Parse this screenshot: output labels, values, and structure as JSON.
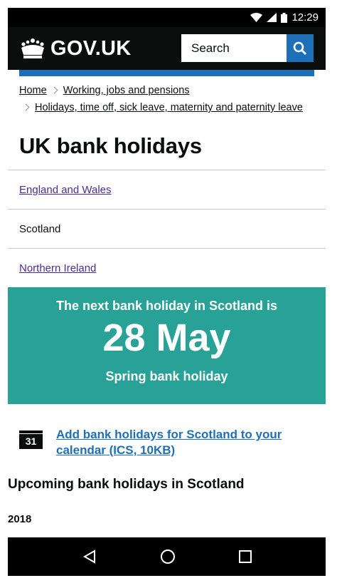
{
  "status": {
    "time": "12:29"
  },
  "header": {
    "logo_text": "GOV.UK",
    "search_placeholder": "Search"
  },
  "breadcrumbs": [
    "Home",
    "Working, jobs and pensions",
    "Holidays, time off, sick leave, maternity and paternity leave"
  ],
  "page_title": "UK bank holidays",
  "tabs": [
    {
      "label": "England and Wales",
      "current": false
    },
    {
      "label": "Scotland",
      "current": true
    },
    {
      "label": "Northern Ireland",
      "current": false
    }
  ],
  "highlight": {
    "intro": "The next bank holiday in Scotland is",
    "date": "28 May",
    "name": "Spring bank holiday"
  },
  "calendar": {
    "icon_day": "31",
    "link_text": "Add bank holidays for Scotland to your calendar (ICS, 10KB)"
  },
  "upcoming_heading": "Upcoming bank holidays in Scotland",
  "year": "2018",
  "colors": {
    "header": "#0b0c0c",
    "brand_blue": "#1d70b8",
    "panel_teal": "#28a197",
    "visited_link": "#4c2c92"
  }
}
